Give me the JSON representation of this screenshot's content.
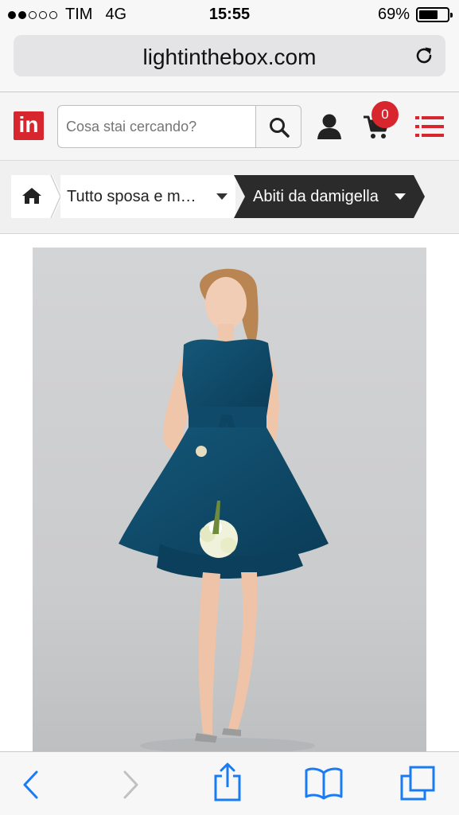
{
  "status_bar": {
    "carrier": "TIM",
    "network": "4G",
    "time": "15:55",
    "battery": "69%",
    "battery_level": 0.69,
    "signal_bars_filled": 2,
    "signal_bars_total": 5
  },
  "browser": {
    "url": "lightinthebox.com",
    "reload_icon": "reload-icon"
  },
  "header": {
    "logo_text": "in",
    "logo_color": "#d8262e",
    "search_placeholder": "Cosa stai cercando?",
    "cart_count": "0",
    "accent_color": "#d8262e",
    "icons": [
      "search-icon",
      "user-icon",
      "cart-icon",
      "menu-icon"
    ]
  },
  "breadcrumb": {
    "home_icon": "home-icon",
    "items": [
      {
        "label": "Tutto sposa e m…"
      },
      {
        "label": "Abiti da damigella"
      }
    ]
  },
  "product": {
    "image": "model-in-teal-bridesmaid-dress",
    "dress_color": "#0f4d6f",
    "background_color": "#cfd0d2"
  },
  "toolbar": {
    "icons": [
      "back-icon",
      "forward-icon",
      "share-icon",
      "bookmarks-icon",
      "tabs-icon"
    ],
    "tint_color": "#1a7cf5"
  }
}
